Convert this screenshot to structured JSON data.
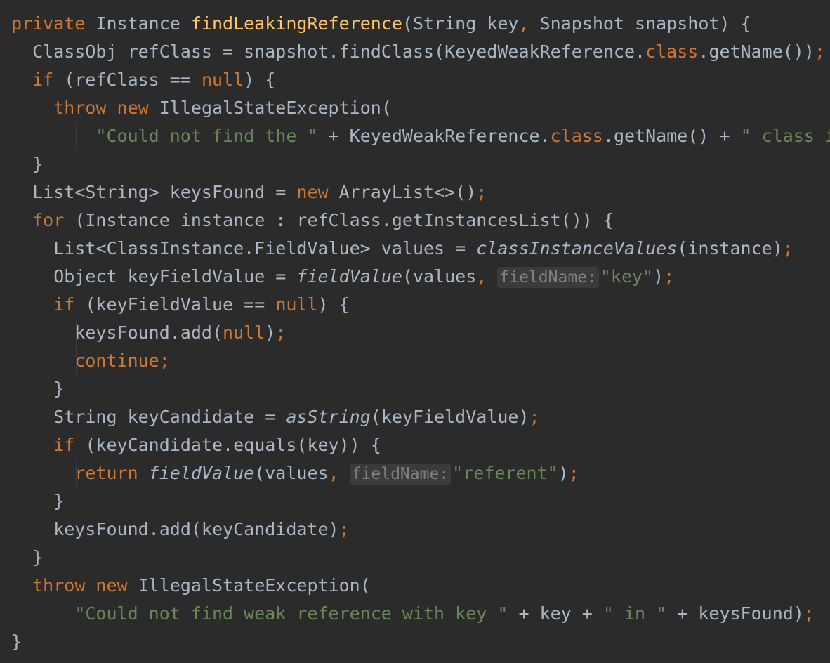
{
  "colors": {
    "background": "#2b2b2b",
    "keyword": "#cc7832",
    "method_declaration": "#ffc66d",
    "string": "#6a8759",
    "default_text": "#a9b7c6",
    "inlay_hint_bg": "#3b3b3b",
    "inlay_hint_text": "#808080",
    "indent_guide": "#3b3b3b"
  },
  "editor": {
    "language": "Java",
    "lines": [
      {
        "guides": [],
        "tokens": [
          {
            "t": "kw",
            "v": "private"
          },
          {
            "t": "p",
            "v": " Instance "
          },
          {
            "t": "fn",
            "v": "findLeakingReference"
          },
          {
            "t": "p",
            "v": "(String key"
          },
          {
            "t": "pc",
            "v": ","
          },
          {
            "t": "p",
            "v": " Snapshot snapshot) {"
          }
        ]
      },
      {
        "guides": [
          1
        ],
        "tokens": [
          {
            "t": "p",
            "v": "  ClassObj refClass = snapshot.findClass(KeyedWeakReference."
          },
          {
            "t": "kw",
            "v": "class"
          },
          {
            "t": "p",
            "v": ".getName())"
          },
          {
            "t": "pc",
            "v": ";"
          }
        ]
      },
      {
        "guides": [
          1
        ],
        "tokens": [
          {
            "t": "p",
            "v": "  "
          },
          {
            "t": "kw",
            "v": "if"
          },
          {
            "t": "p",
            "v": " (refClass == "
          },
          {
            "t": "kw",
            "v": "null"
          },
          {
            "t": "p",
            "v": ") {"
          }
        ]
      },
      {
        "guides": [
          1,
          2
        ],
        "tokens": [
          {
            "t": "p",
            "v": "    "
          },
          {
            "t": "kw",
            "v": "throw new"
          },
          {
            "t": "p",
            "v": " IllegalStateException("
          }
        ]
      },
      {
        "guides": [
          1,
          2,
          3
        ],
        "tokens": [
          {
            "t": "p",
            "v": "        "
          },
          {
            "t": "str",
            "v": "\"Could not find the \""
          },
          {
            "t": "p",
            "v": " + KeyedWeakReference."
          },
          {
            "t": "kw",
            "v": "class"
          },
          {
            "t": "p",
            "v": ".getName() + "
          },
          {
            "t": "str",
            "v": "\" class in snapshot.\""
          }
        ]
      },
      {
        "guides": [
          1
        ],
        "tokens": [
          {
            "t": "p",
            "v": "  }"
          }
        ]
      },
      {
        "guides": [
          1
        ],
        "tokens": [
          {
            "t": "p",
            "v": "  List<String> keysFound = "
          },
          {
            "t": "kw",
            "v": "new"
          },
          {
            "t": "p",
            "v": " ArrayList<>()"
          },
          {
            "t": "pc",
            "v": ";"
          }
        ]
      },
      {
        "guides": [
          1
        ],
        "tokens": [
          {
            "t": "p",
            "v": "  "
          },
          {
            "t": "kw",
            "v": "for"
          },
          {
            "t": "p",
            "v": " (Instance instance : refClass.getInstancesList()) {"
          }
        ]
      },
      {
        "guides": [
          1,
          2
        ],
        "tokens": [
          {
            "t": "p",
            "v": "    List<ClassInstance.FieldValue> values = "
          },
          {
            "t": "it",
            "v": "classInstanceValues"
          },
          {
            "t": "p",
            "v": "(instance)"
          },
          {
            "t": "pc",
            "v": ";"
          }
        ]
      },
      {
        "guides": [
          1,
          2
        ],
        "tokens": [
          {
            "t": "p",
            "v": "    Object keyFieldValue = "
          },
          {
            "t": "it",
            "v": "fieldValue"
          },
          {
            "t": "p",
            "v": "(values"
          },
          {
            "t": "pc",
            "v": ","
          },
          {
            "t": "p",
            "v": " "
          },
          {
            "t": "hint",
            "v": "fieldName:"
          },
          {
            "t": "str",
            "v": "\"key\""
          },
          {
            "t": "p",
            "v": ")"
          },
          {
            "t": "pc",
            "v": ";"
          }
        ]
      },
      {
        "guides": [
          1,
          2
        ],
        "tokens": [
          {
            "t": "p",
            "v": "    "
          },
          {
            "t": "kw",
            "v": "if"
          },
          {
            "t": "p",
            "v": " (keyFieldValue == "
          },
          {
            "t": "kw",
            "v": "null"
          },
          {
            "t": "p",
            "v": ") {"
          }
        ]
      },
      {
        "guides": [
          1,
          2,
          3
        ],
        "tokens": [
          {
            "t": "p",
            "v": "      keysFound.add("
          },
          {
            "t": "kw",
            "v": "null"
          },
          {
            "t": "p",
            "v": ")"
          },
          {
            "t": "pc",
            "v": ";"
          }
        ]
      },
      {
        "guides": [
          1,
          2,
          3
        ],
        "tokens": [
          {
            "t": "p",
            "v": "      "
          },
          {
            "t": "kw",
            "v": "continue"
          },
          {
            "t": "pc",
            "v": ";"
          }
        ]
      },
      {
        "guides": [
          1,
          2
        ],
        "tokens": [
          {
            "t": "p",
            "v": "    }"
          }
        ]
      },
      {
        "guides": [
          1,
          2
        ],
        "tokens": [
          {
            "t": "p",
            "v": "    String keyCandidate = "
          },
          {
            "t": "it",
            "v": "asString"
          },
          {
            "t": "p",
            "v": "(keyFieldValue)"
          },
          {
            "t": "pc",
            "v": ";"
          }
        ]
      },
      {
        "guides": [
          1,
          2
        ],
        "tokens": [
          {
            "t": "p",
            "v": "    "
          },
          {
            "t": "kw",
            "v": "if"
          },
          {
            "t": "p",
            "v": " (keyCandidate.equals(key)) {"
          }
        ]
      },
      {
        "guides": [
          1,
          2,
          3
        ],
        "tokens": [
          {
            "t": "p",
            "v": "      "
          },
          {
            "t": "kw",
            "v": "return"
          },
          {
            "t": "p",
            "v": " "
          },
          {
            "t": "it",
            "v": "fieldValue"
          },
          {
            "t": "p",
            "v": "(values"
          },
          {
            "t": "pc",
            "v": ","
          },
          {
            "t": "p",
            "v": " "
          },
          {
            "t": "hint",
            "v": "fieldName:"
          },
          {
            "t": "str",
            "v": "\"referent\""
          },
          {
            "t": "p",
            "v": ")"
          },
          {
            "t": "pc",
            "v": ";"
          }
        ]
      },
      {
        "guides": [
          1,
          2
        ],
        "tokens": [
          {
            "t": "p",
            "v": "    }"
          }
        ]
      },
      {
        "guides": [
          1,
          2
        ],
        "tokens": [
          {
            "t": "p",
            "v": "    keysFound.add(keyCandidate)"
          },
          {
            "t": "pc",
            "v": ";"
          }
        ]
      },
      {
        "guides": [
          1
        ],
        "tokens": [
          {
            "t": "p",
            "v": "  }"
          }
        ]
      },
      {
        "guides": [
          1
        ],
        "tokens": [
          {
            "t": "p",
            "v": "  "
          },
          {
            "t": "kw",
            "v": "throw new"
          },
          {
            "t": "p",
            "v": " IllegalStateException("
          }
        ]
      },
      {
        "guides": [
          1,
          2
        ],
        "tokens": [
          {
            "t": "p",
            "v": "      "
          },
          {
            "t": "str",
            "v": "\"Could not find weak reference with key \""
          },
          {
            "t": "p",
            "v": " + key + "
          },
          {
            "t": "str",
            "v": "\" in \""
          },
          {
            "t": "p",
            "v": " + keysFound)"
          },
          {
            "t": "pc",
            "v": ";"
          }
        ]
      },
      {
        "guides": [],
        "tokens": [
          {
            "t": "p",
            "v": "}"
          }
        ]
      }
    ]
  }
}
